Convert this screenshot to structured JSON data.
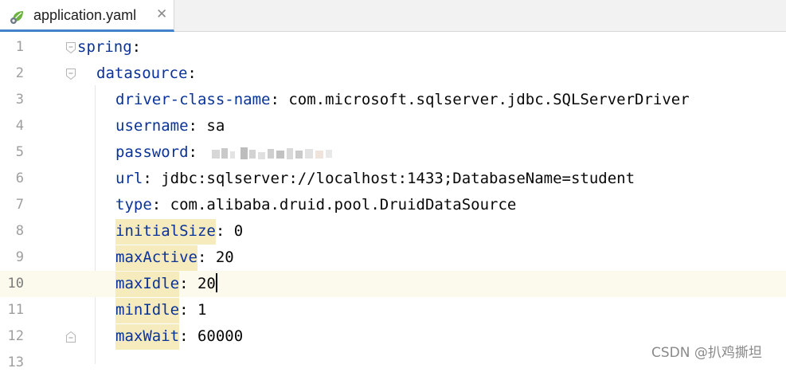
{
  "tab": {
    "title": "application.yaml",
    "close_glyph": "✕",
    "icon": "spring-leaf-icon",
    "accent": "#4083c9"
  },
  "editor": {
    "current_line": 10,
    "lines": [
      {
        "number": "1",
        "key": "spring",
        "sep": ":",
        "value": ""
      },
      {
        "number": "2",
        "key": "datasource",
        "sep": ":",
        "value": ""
      },
      {
        "number": "3",
        "key": "driver-class-name",
        "sep": ": ",
        "value": "com.microsoft.sqlserver.jdbc.SQLServerDriver"
      },
      {
        "number": "4",
        "key": "username",
        "sep": ": ",
        "value": "sa"
      },
      {
        "number": "5",
        "key": "password",
        "sep": ": ",
        "value": ""
      },
      {
        "number": "6",
        "key": "url",
        "sep": ": ",
        "value": "jdbc:sqlserver://localhost:1433;DatabaseName=student"
      },
      {
        "number": "7",
        "key": "type",
        "sep": ": ",
        "value": "com.alibaba.druid.pool.DruidDataSource"
      },
      {
        "number": "8",
        "key": "initialSize",
        "sep": ": ",
        "value": "0"
      },
      {
        "number": "9",
        "key": "maxActive",
        "sep": ": ",
        "value": "20"
      },
      {
        "number": "10",
        "key": "maxIdle",
        "sep": ": ",
        "value": "20"
      },
      {
        "number": "11",
        "key": "minIdle",
        "sep": ": ",
        "value": "1"
      },
      {
        "number": "12",
        "key": "maxWait",
        "sep": ": ",
        "value": "60000"
      },
      {
        "number": "13",
        "key": "",
        "sep": "",
        "value": ""
      }
    ]
  },
  "watermark": "CSDN @扒鸡撕坦",
  "colors": {
    "key": "#0a3399",
    "highlight": "#f6ebbc",
    "current_line": "#fcfaed"
  }
}
